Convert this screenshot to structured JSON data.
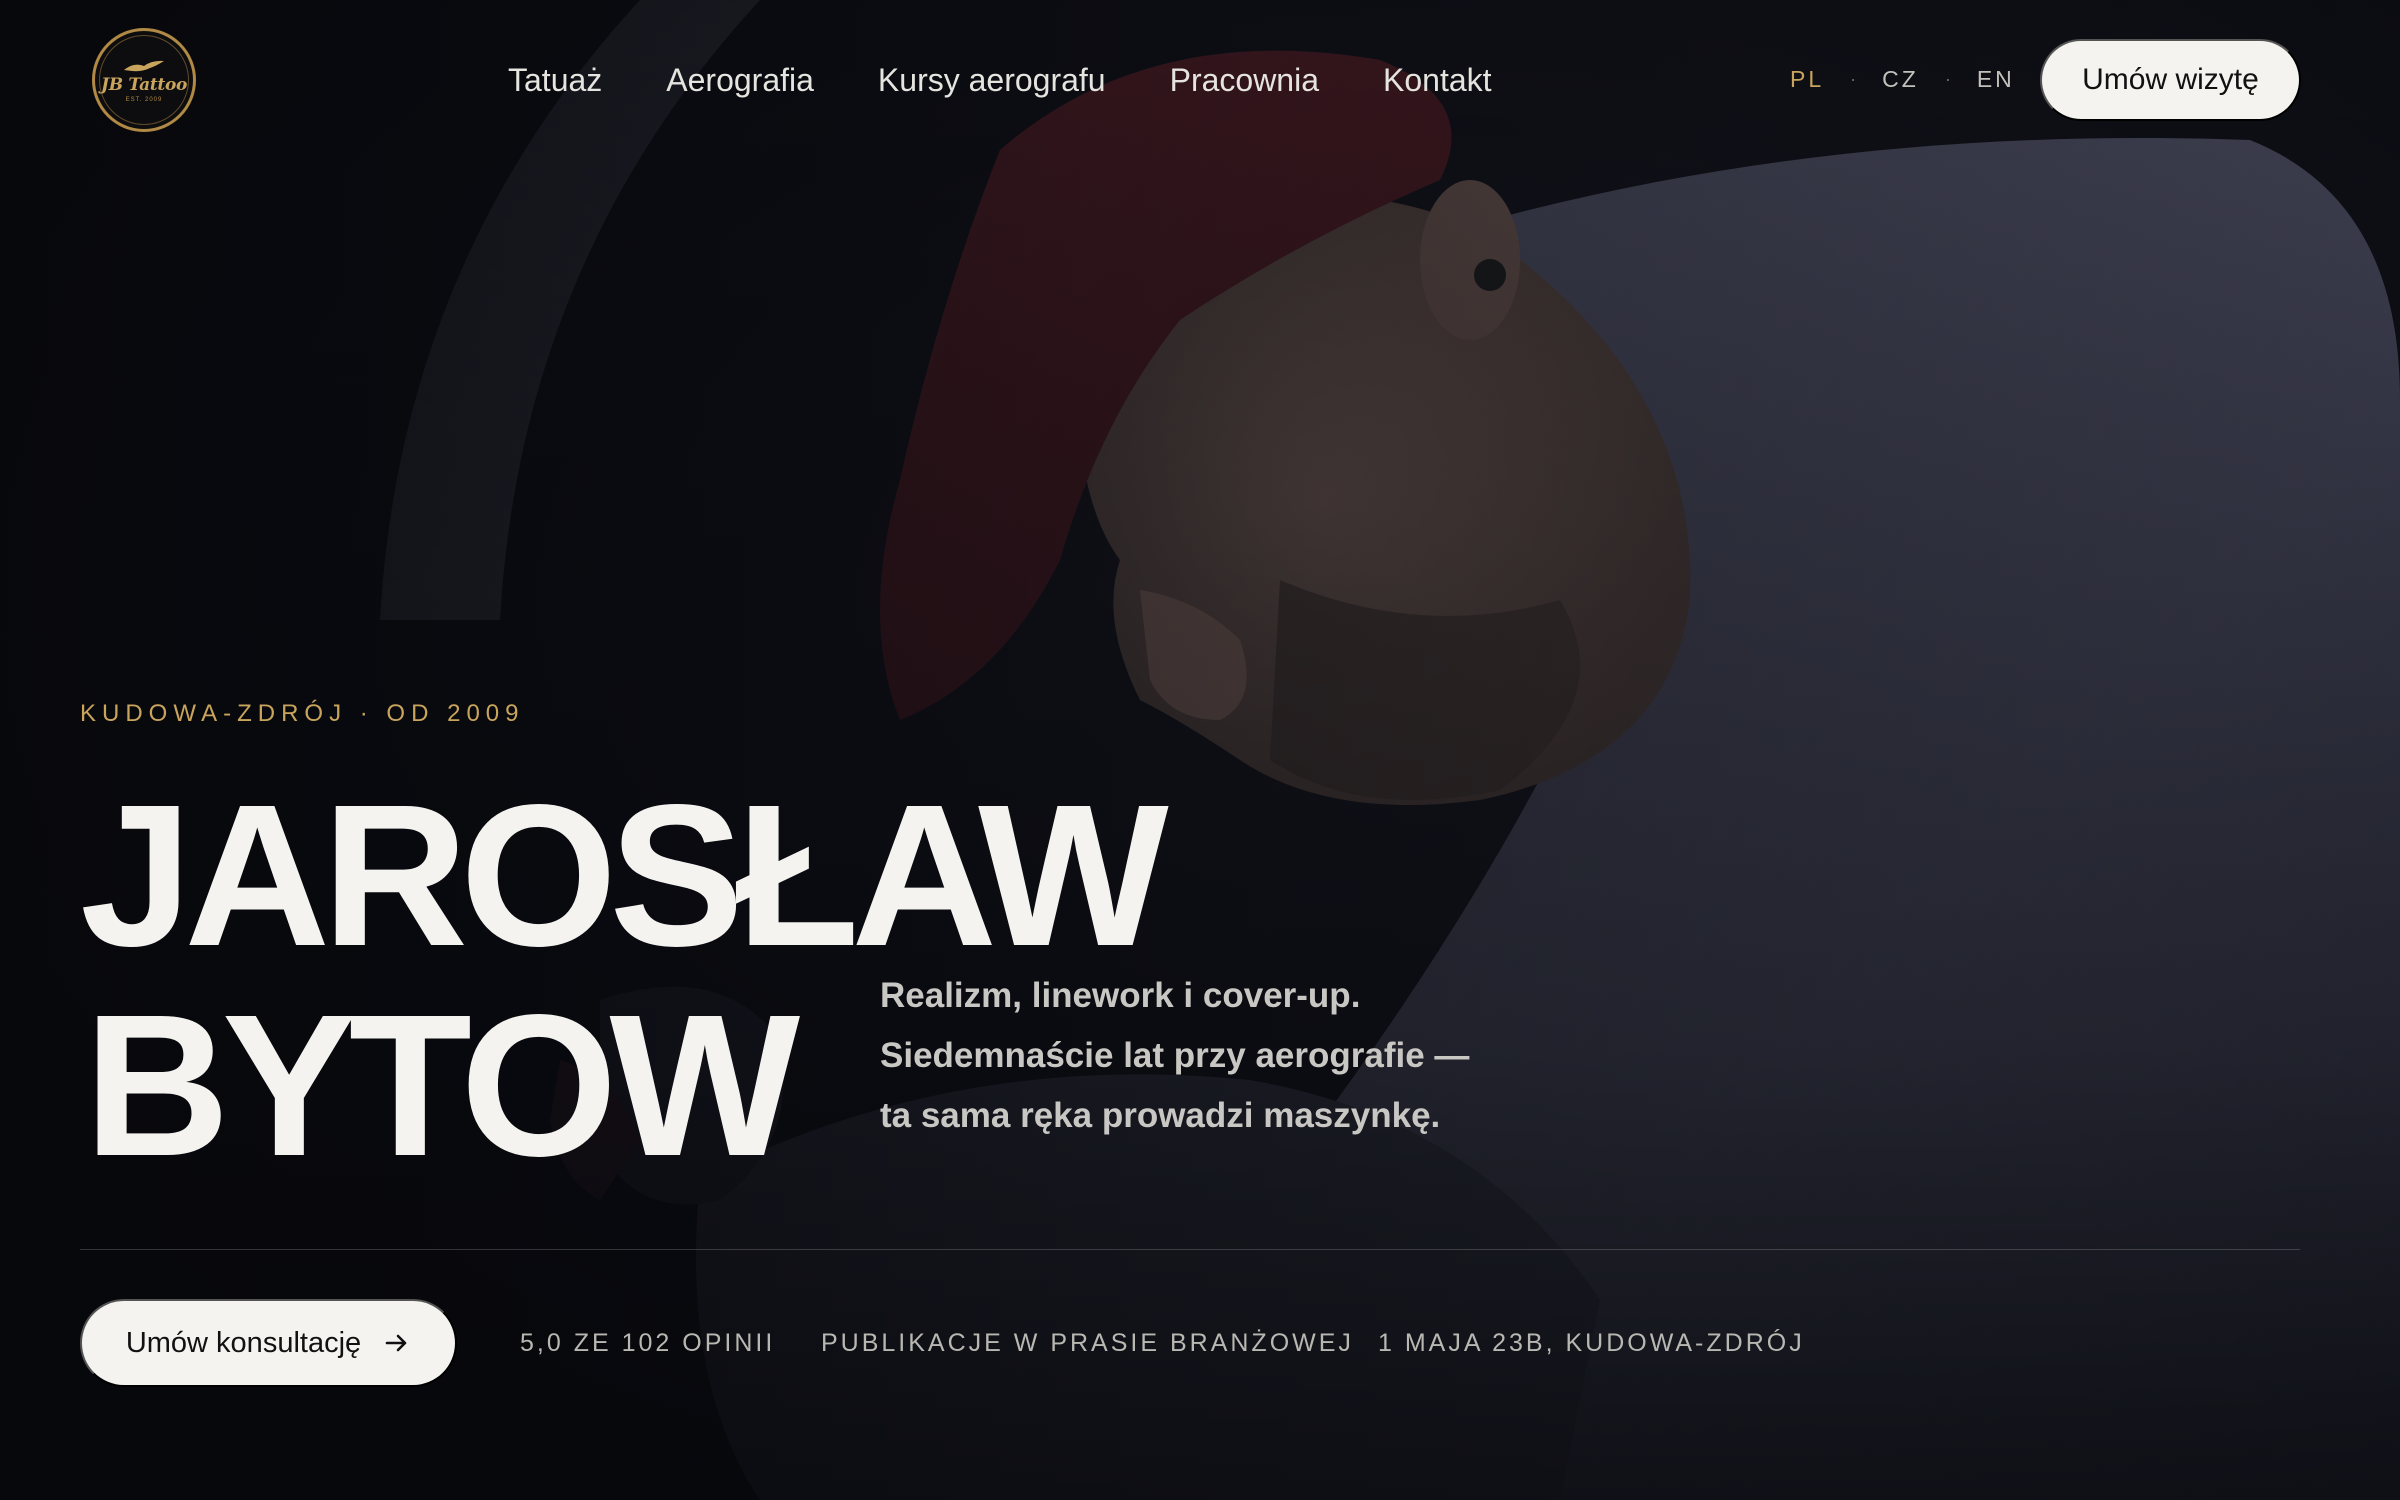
{
  "brand": {
    "logo_text": "JB Tattoo",
    "logo_sub": "EST. 2009",
    "gold": "#c9a45c"
  },
  "nav": {
    "items": [
      {
        "label": "Tatuaż"
      },
      {
        "label": "Aerografia"
      },
      {
        "label": "Kursy aerografu"
      },
      {
        "label": "Pracownia"
      },
      {
        "label": "Kontakt"
      }
    ]
  },
  "languages": {
    "items": [
      {
        "label": "PL",
        "active": true
      },
      {
        "label": "CZ",
        "active": false
      },
      {
        "label": "EN",
        "active": false
      }
    ],
    "separator": "·"
  },
  "header": {
    "cta_label": "Umów wizytę"
  },
  "hero": {
    "eyebrow": "KUDOWA-ZDRÓJ · OD 2009",
    "name_line1": "JAROSŁAW",
    "name_line2": "BYTOW",
    "tagline": [
      "Realizm, linework i cover-up.",
      "Siedemnaście lat przy aerografie —",
      "ta sama ręka prowadzi maszynkę."
    ],
    "cta_label": "Umów konsultację",
    "cta_icon": "arrow-right-icon",
    "meta": [
      "5,0 ZE 102 OPINII",
      "PUBLIKACJE W PRASIE BRANŻOWEJ",
      "1 MAJA 23B, KUDOWA-ZDRÓJ"
    ]
  }
}
